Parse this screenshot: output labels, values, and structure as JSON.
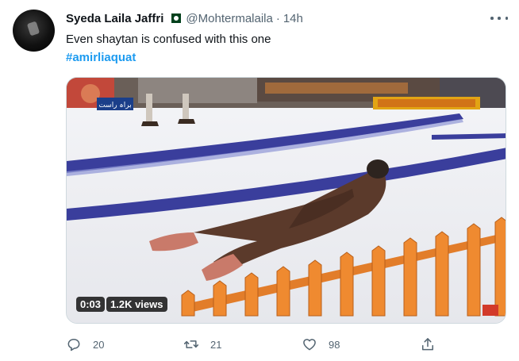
{
  "tweet": {
    "author_name": "Syeda Laila Jaffri",
    "author_flag": "pakistan-flag-emoji",
    "handle": "@Mohtermalaila",
    "separator": "·",
    "time": "14h",
    "text": "Even shaytan is confused with this one",
    "hashtag": "#amirliaquat"
  },
  "media": {
    "duration": "0:03",
    "views": "1.2K views",
    "channel_tag": "براہ راست"
  },
  "actions": {
    "replies": "20",
    "retweets": "21",
    "likes": "98"
  },
  "icons": {
    "more": "more-icon",
    "reply": "reply-icon",
    "retweet": "retweet-icon",
    "like": "heart-icon",
    "share": "share-icon"
  },
  "colors": {
    "accent": "#1d9bf0",
    "secondary_text": "#536471",
    "primary_text": "#0f1419"
  }
}
